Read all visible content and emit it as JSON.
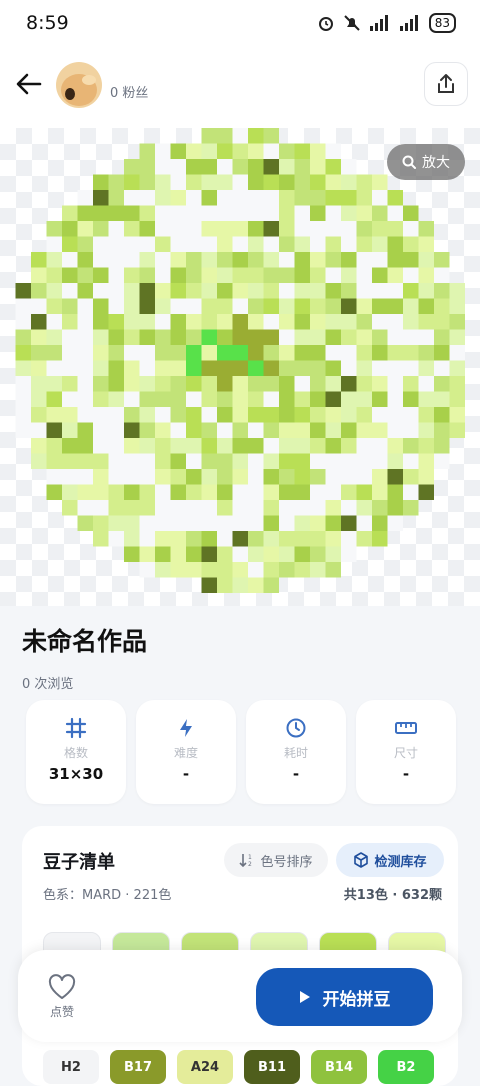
{
  "status_bar": {
    "time": "8:59",
    "battery": "83",
    "icons": [
      "alarm-icon",
      "mute-icon",
      "signal-icon",
      "signal-icon-2",
      "battery-icon"
    ]
  },
  "header": {
    "fans": "0 粉丝",
    "back_icon": "arrow-left-icon",
    "share_icon": "share-icon"
  },
  "canvas": {
    "zoom_label": "放大",
    "zoom_icon": "magnifier-icon"
  },
  "work": {
    "title": "未命名作品",
    "views": "0 次浏览"
  },
  "stats": [
    {
      "icon": "grid-icon",
      "label": "格数",
      "value": "31×30"
    },
    {
      "icon": "bolt-icon",
      "label": "难度",
      "value": "-"
    },
    {
      "icon": "clock-icon",
      "label": "耗时",
      "value": "-"
    },
    {
      "icon": "ruler-icon",
      "label": "尺寸",
      "value": "-"
    }
  ],
  "beans": {
    "title": "豆子清单",
    "sort_label": "色号排序",
    "check_label": "检测库存",
    "meta": "色系：MARD · 221色",
    "total": "共13色 · 632颗",
    "swatches": [
      "#f3f4f6",
      "#c5e89a",
      "#c2e378",
      "#dff5b0",
      "#b9df55",
      "#e6f7a6"
    ],
    "codes": [
      "H2",
      "B17",
      "A24",
      "B11",
      "B14",
      "B2"
    ],
    "code_colors": [
      "#f3f4f6",
      "#8a9a2a",
      "#e4ec9a",
      "#4f5e1c",
      "#8fc23e",
      "#45d246"
    ]
  },
  "actions": {
    "like_label": "点赞",
    "start_label": "开始拼豆"
  },
  "colors": {
    "primary": "#1558b8",
    "accent_light": "#e6effb"
  }
}
